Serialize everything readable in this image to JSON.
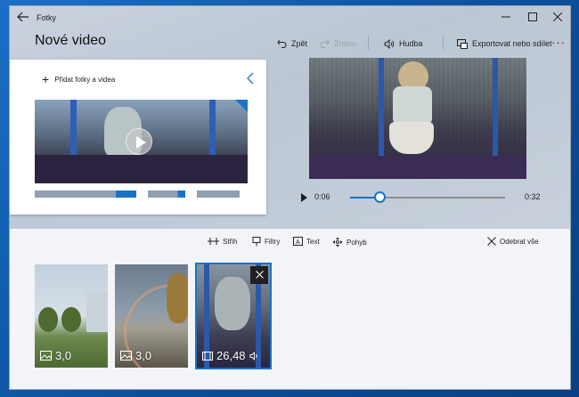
{
  "app": {
    "title": "Fotky"
  },
  "page": {
    "title": "Nové video"
  },
  "commands": {
    "undo": "Zpět",
    "redo": "Znovu",
    "music": "Hudba",
    "export": "Exportovat nebo sdílet"
  },
  "library": {
    "add_label": "Přidat fotky a videa"
  },
  "player": {
    "current_time": "0:06",
    "total_time": "0:32",
    "progress_fraction": 0.19
  },
  "storyboard": {
    "tools": {
      "trim": "Střih",
      "filters": "Filtry",
      "text": "Text",
      "motion": "Pohyb",
      "remove_all": "Odebrat vše"
    },
    "clips": [
      {
        "type": "photo",
        "duration": "3,0"
      },
      {
        "type": "photo",
        "duration": "3,0"
      },
      {
        "type": "video",
        "duration": "26,48",
        "audio": true,
        "selected": true
      }
    ]
  },
  "colors": {
    "accent": "#1a73c9"
  }
}
